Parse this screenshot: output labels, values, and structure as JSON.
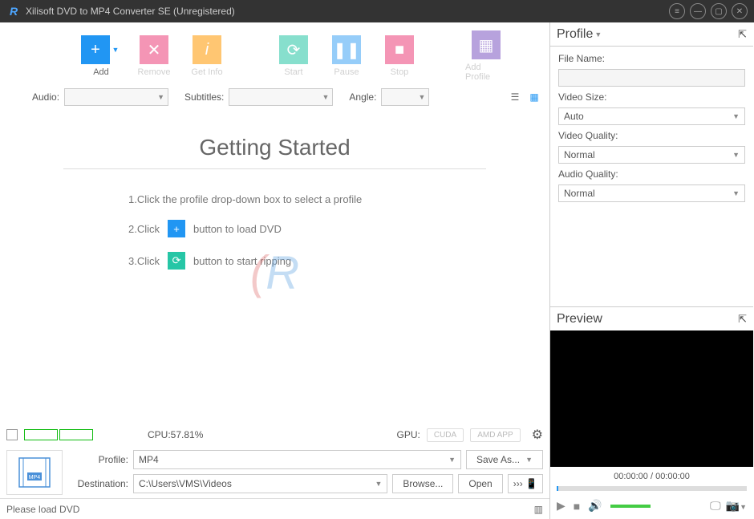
{
  "titlebar": {
    "title": "Xilisoft DVD to MP4 Converter SE (Unregistered)"
  },
  "toolbar": {
    "add": "Add",
    "remove": "Remove",
    "getinfo": "Get Info",
    "start": "Start",
    "pause": "Pause",
    "stop": "Stop",
    "addprofile": "Add Profile"
  },
  "filter": {
    "audio": "Audio:",
    "subtitles": "Subtitles:",
    "angle": "Angle:"
  },
  "getting_started": {
    "title": "Getting Started",
    "step1": "1.Click the profile drop-down box to select a profile",
    "step2_a": "2.Click",
    "step2_b": "button to load DVD",
    "step3_a": "3.Click",
    "step3_b": "button to start ripping"
  },
  "status": {
    "cpu": "CPU:57.81%",
    "gpu": "GPU:",
    "cuda": "CUDA",
    "amd": "AMD APP"
  },
  "dest": {
    "profile_label": "Profile:",
    "profile_value": "MP4",
    "saveas": "Save As...",
    "dest_label": "Destination:",
    "dest_value": "C:\\Users\\VMS\\Videos",
    "browse": "Browse...",
    "open": "Open"
  },
  "footer": {
    "status": "Please load DVD"
  },
  "profile": {
    "header": "Profile",
    "filename": "File Name:",
    "videosize_label": "Video Size:",
    "videosize_value": "Auto",
    "videoquality_label": "Video Quality:",
    "videoquality_value": "Normal",
    "audioquality_label": "Audio Quality:",
    "audioquality_value": "Normal"
  },
  "preview": {
    "header": "Preview",
    "time": "00:00:00 / 00:00:00"
  }
}
